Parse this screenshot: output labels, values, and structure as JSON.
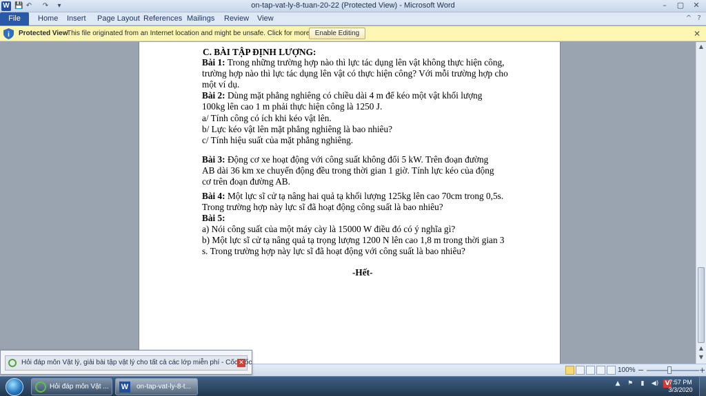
{
  "window": {
    "title": "on-tap-vat-ly-8-tuan-20-22 (Protected View)  -  Microsoft Word",
    "minimize": "–",
    "maximize": "▢",
    "close": "✕",
    "quick_access": {
      "save": "💾",
      "undo": "↶",
      "redo": "↷",
      "customize": "▾"
    }
  },
  "ribbon": {
    "tabs": [
      "File",
      "Home",
      "Insert",
      "Page Layout",
      "References",
      "Mailings",
      "Review",
      "View"
    ],
    "help_icon": "?",
    "minimize_ribbon_icon": "^"
  },
  "protected_view": {
    "label": "Protected View",
    "message": "This file originated from an Internet location and might be unsafe. Click for more details.",
    "button": "Enable Editing",
    "close": "✕"
  },
  "document": {
    "heading": "C. BÀI TẬP ĐỊNH LƯỢNG:",
    "lines": [
      {
        "bold": "Bài 1:",
        "text": " Trong những trường hợp nào thì lực tác dụng lên vật không thực hiện công,"
      },
      {
        "bold": "",
        "text": "trường hợp nào thì lực tác dụng lên vật có thực hiện công? Với mỗi trường hợp cho"
      },
      {
        "bold": "",
        "text": "một ví dụ."
      },
      {
        "bold": "Bài 2:",
        "text": " Dùng mặt phẳng nghiêng có chiều dài 4 m để kéo một vật khối lượng"
      },
      {
        "bold": "",
        "text": "100kg lên cao 1 m phải thực hiện công là 1250 J."
      },
      {
        "bold": "",
        "text": "a/ Tính công có ích khi kéo vật lên."
      },
      {
        "bold": "",
        "text": "b/ Lực kéo vật lên mặt phẳng nghiêng là bao nhiêu?"
      },
      {
        "bold": "",
        "text": "c/ Tính hiệu suất của mặt phẳng nghiêng."
      },
      {
        "bold": "Bài 3:",
        "text": " Động cơ xe hoạt động với công suất không đổi 5 kW. Trên đoạn đường"
      },
      {
        "bold": "",
        "text": "AB dài 36 km xe chuyển động đều trong thời gian 1 giờ. Tính lực kéo của động"
      },
      {
        "bold": "",
        "text": "cơ trên đoạn đường AB."
      },
      {
        "bold": "Bài 4:",
        "text": " Một lực sĩ cử tạ nâng hai quả tạ khối lượng 125kg lên cao 70cm trong 0,5s."
      },
      {
        "bold": "",
        "text": "Trong trường hợp này lực sĩ đã hoạt động công suất là bao nhiêu?"
      },
      {
        "bold": "Bài 5:",
        "text": ""
      },
      {
        "bold": "",
        "text": "a) Nói công suất của một máy cày là 15000 W điều đó có ý nghĩa gì?"
      },
      {
        "bold": "",
        "text": "b) Một lực sĩ cử tạ nâng quả tạ trọng lượng 1200 N lên cao 1,8 m trong thời gian 3"
      },
      {
        "bold": "",
        "text": "s. Trong trường hợp này lực sĩ đã hoạt động với công suất là bao nhiêu?"
      }
    ],
    "end_mark": "-Hết-"
  },
  "statusbar": {
    "zoom": "100%",
    "zoom_minus": "−",
    "zoom_plus": "+"
  },
  "notification": {
    "text": "Hỏi đáp môn Vật lý, giải bài tập vật lý cho tất cả các lớp miễn phí - Cốc Cốc",
    "close": "✕"
  },
  "taskbar": {
    "items": [
      {
        "label": "Hỏi đáp môn Vật ..."
      },
      {
        "label": "on-tap-vat-ly-8-t..."
      }
    ],
    "clock_time": "7:57 PM",
    "clock_date": "3/3/2020",
    "tray": {
      "arrow": "▲",
      "flag": "⚑",
      "battery": "▮",
      "volume": "◀)",
      "app": "V"
    }
  },
  "colors": {
    "word_blue": "#2a5aa7",
    "protected_bar": "#fdf5b2",
    "taskbar": "#2f4a68"
  }
}
